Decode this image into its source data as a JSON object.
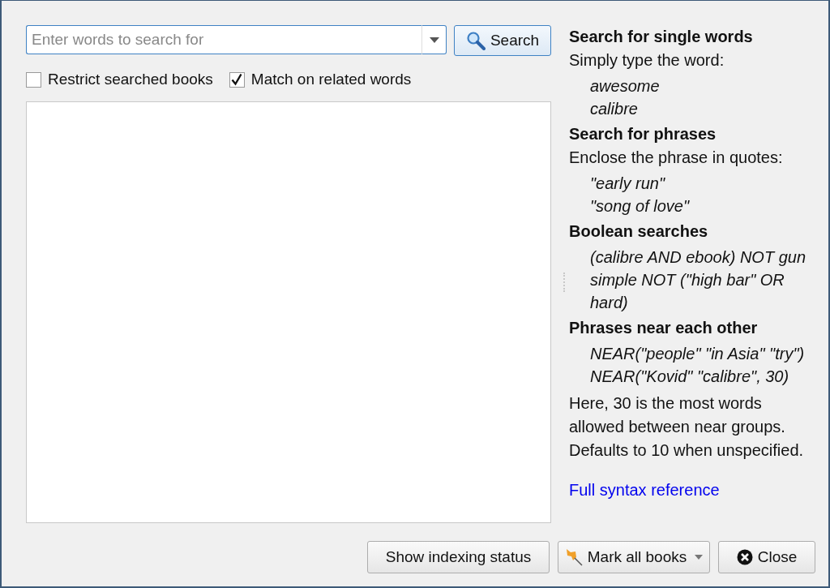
{
  "search": {
    "placeholder": "Enter words to search for",
    "button": "Search"
  },
  "options": [
    {
      "label": "Restrict searched books",
      "checked": false
    },
    {
      "label": "Match on related words",
      "checked": true
    }
  ],
  "help": {
    "sections": [
      {
        "heading": "Search for single words",
        "intro": "Simply type the word:",
        "examples": [
          "awesome",
          "calibre"
        ]
      },
      {
        "heading": "Search for phrases",
        "intro": "Enclose the phrase in quotes:",
        "examples": [
          "\"early run\"",
          "\"song of love\""
        ]
      },
      {
        "heading": "Boolean searches",
        "examples": [
          "(calibre AND ebook) NOT gun",
          "simple NOT (\"high bar\" OR hard)"
        ]
      },
      {
        "heading": "Phrases near each other",
        "examples": [
          "NEAR(\"people\" \"in Asia\" \"try\")",
          "NEAR(\"Kovid\" \"calibre\", 30)"
        ]
      }
    ],
    "note": "Here, 30 is the most words allowed between near groups. Defaults to 10 when unspecified.",
    "link": "Full syntax reference"
  },
  "buttons": [
    {
      "kind": "plain",
      "label": "Show indexing status"
    },
    {
      "kind": "menu",
      "label": "Mark all books"
    },
    {
      "kind": "close",
      "label": "Close"
    }
  ]
}
